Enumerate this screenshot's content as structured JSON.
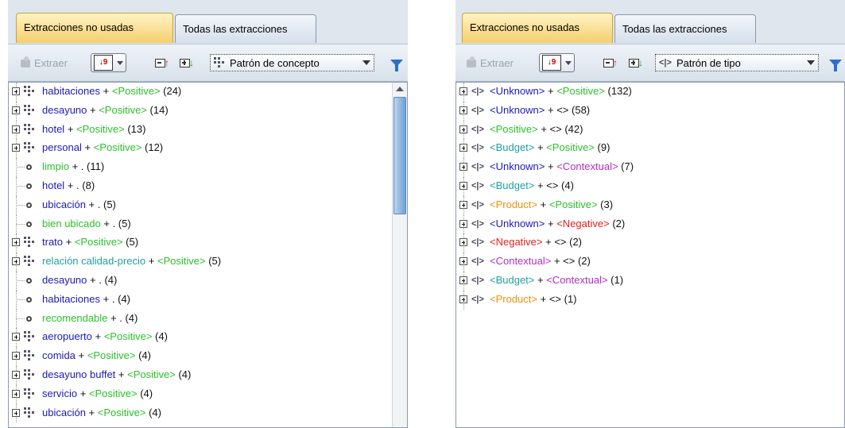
{
  "colors": {
    "concept": "#1a1ab8",
    "positive": "#2bbf2b",
    "budget": "#1f9fa0",
    "contextual": "#b030c0",
    "negative": "#e51e1e",
    "product": "#f0900a",
    "active_tab": "#f5cf6d"
  },
  "left": {
    "tabs": [
      "Extracciones no usadas",
      "Todas las extracciones"
    ],
    "toolbar": {
      "extract_label": "Extraer",
      "pattern_label": "Patrón de concepto"
    },
    "items": [
      {
        "kind": "group",
        "c": "habitaciones",
        "plus": " + ",
        "s": "<Positive>",
        "sc": "green",
        "n": " (24)"
      },
      {
        "kind": "group",
        "c": "desayuno",
        "plus": " + ",
        "s": "<Positive>",
        "sc": "green",
        "n": " (14)"
      },
      {
        "kind": "group",
        "c": "hotel",
        "plus": " + ",
        "s": "<Positive>",
        "sc": "green",
        "n": " (13)"
      },
      {
        "kind": "group",
        "c": "personal",
        "plus": " + ",
        "s": "<Positive>",
        "sc": "green",
        "n": " (12)"
      },
      {
        "kind": "leaf",
        "c": "limpio",
        "cc": "green",
        "plus": " + ",
        "s": " . ",
        "sc": "black",
        "n": " (11)"
      },
      {
        "kind": "leaf",
        "c": "hotel",
        "cc": "blue",
        "plus": " + ",
        "s": " . ",
        "sc": "black",
        "n": " (8)"
      },
      {
        "kind": "leaf",
        "c": "ubicación",
        "cc": "blue",
        "plus": " + ",
        "s": " . ",
        "sc": "black",
        "n": " (5)"
      },
      {
        "kind": "leaf",
        "c": "bien ubicado",
        "cc": "green",
        "plus": " + ",
        "s": " . ",
        "sc": "black",
        "n": " (5)"
      },
      {
        "kind": "group",
        "c": "trato",
        "plus": " + ",
        "s": "<Positive>",
        "sc": "green",
        "n": " (5)"
      },
      {
        "kind": "group",
        "c": "relación calidad-precio",
        "cc": "teal",
        "plus": " + ",
        "s": "<Positive>",
        "sc": "green",
        "n": " (5)"
      },
      {
        "kind": "leaf",
        "c": "desayuno",
        "cc": "blue",
        "plus": " + ",
        "s": " . ",
        "sc": "black",
        "n": " (4)"
      },
      {
        "kind": "leaf",
        "c": "habitaciones",
        "cc": "blue",
        "plus": " + ",
        "s": " . ",
        "sc": "black",
        "n": " (4)"
      },
      {
        "kind": "leaf",
        "c": "recomendable",
        "cc": "green",
        "plus": " + ",
        "s": " . ",
        "sc": "black",
        "n": " (4)"
      },
      {
        "kind": "group",
        "c": "aeropuerto",
        "plus": " + ",
        "s": "<Positive>",
        "sc": "green",
        "n": " (4)"
      },
      {
        "kind": "group",
        "c": "comida",
        "plus": " + ",
        "s": "<Positive>",
        "sc": "green",
        "n": " (4)"
      },
      {
        "kind": "group",
        "c": "desayuno buffet",
        "plus": " + ",
        "s": "<Positive>",
        "sc": "green",
        "n": " (4)"
      },
      {
        "kind": "group",
        "c": "servicio",
        "plus": " + ",
        "s": "<Positive>",
        "sc": "green",
        "n": " (4)"
      },
      {
        "kind": "group",
        "c": "ubicación",
        "plus": " + ",
        "s": "<Positive>",
        "sc": "green",
        "n": " (4)"
      }
    ]
  },
  "right": {
    "tabs": [
      "Extracciones no usadas",
      "Todas las extracciones"
    ],
    "toolbar": {
      "extract_label": "Extraer",
      "pattern_label": "Patrón de tipo"
    },
    "items": [
      {
        "a": "<Unknown>",
        "ac": "blue",
        "b": "<Positive>",
        "bc": "green",
        "n": " (132)"
      },
      {
        "a": "<Unknown>",
        "ac": "blue",
        "b": "<>",
        "bc": "black",
        "n": " (58)"
      },
      {
        "a": "<Positive>",
        "ac": "green",
        "b": "<>",
        "bc": "black",
        "n": " (42)"
      },
      {
        "a": "<Budget>",
        "ac": "teal",
        "b": "<Positive>",
        "bc": "green",
        "n": " (9)"
      },
      {
        "a": "<Unknown>",
        "ac": "blue",
        "b": "<Contextual>",
        "bc": "purple",
        "n": " (7)"
      },
      {
        "a": "<Budget>",
        "ac": "teal",
        "b": "<>",
        "bc": "black",
        "n": " (4)"
      },
      {
        "a": "<Product>",
        "ac": "orange",
        "b": "<Positive>",
        "bc": "green",
        "n": " (3)"
      },
      {
        "a": "<Unknown>",
        "ac": "blue",
        "b": "<Negative>",
        "bc": "red",
        "n": " (2)"
      },
      {
        "a": "<Negative>",
        "ac": "red",
        "b": "<>",
        "bc": "black",
        "n": " (2)"
      },
      {
        "a": "<Contextual>",
        "ac": "purple",
        "b": "<>",
        "bc": "black",
        "n": " (2)"
      },
      {
        "a": "<Budget>",
        "ac": "teal",
        "b": "<Contextual>",
        "bc": "purple",
        "n": " (1)"
      },
      {
        "a": "<Product>",
        "ac": "orange",
        "b": "<>",
        "bc": "black",
        "n": " (1)"
      }
    ]
  }
}
